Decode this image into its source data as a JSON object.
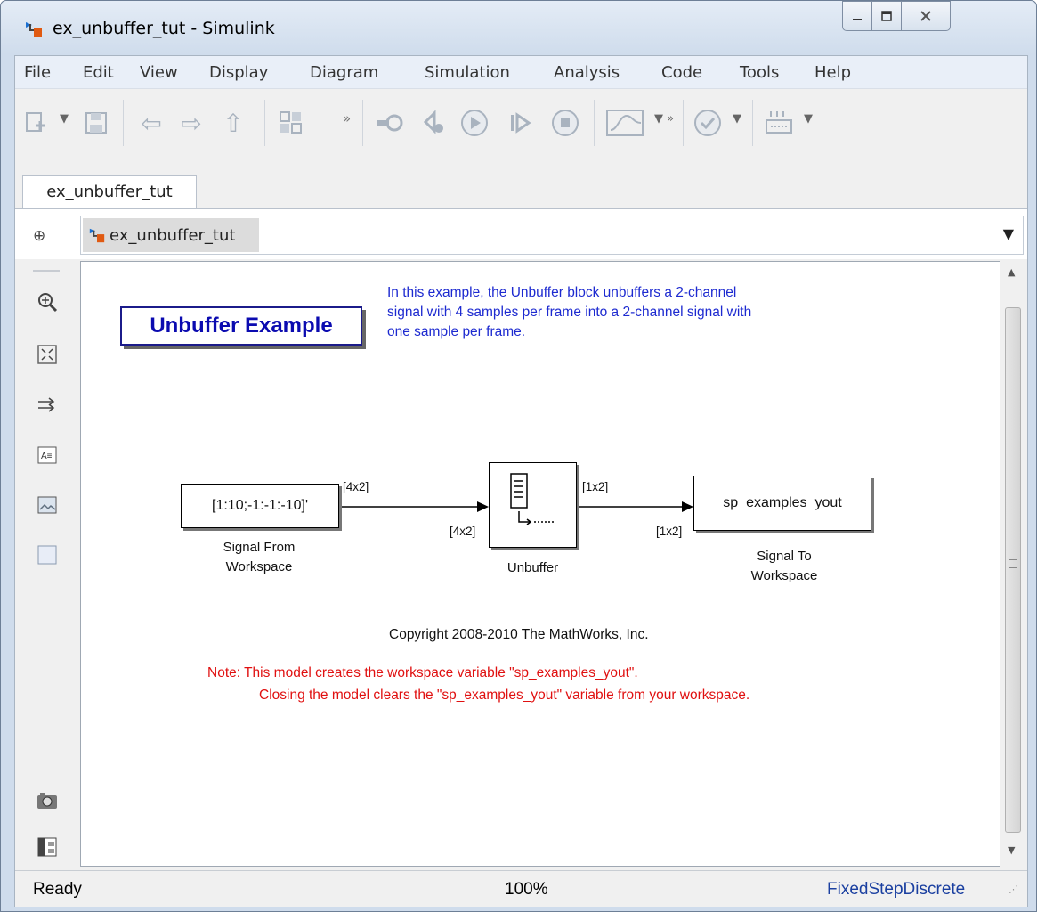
{
  "window": {
    "title": "ex_unbuffer_tut - Simulink"
  },
  "menu": [
    "File",
    "Edit",
    "View",
    "Display",
    "Diagram",
    "Simulation",
    "Analysis",
    "Code",
    "Tools",
    "Help"
  ],
  "tab": {
    "label": "ex_unbuffer_tut"
  },
  "address": {
    "crumb": "ex_unbuffer_tut"
  },
  "diagram": {
    "title": "Unbuffer Example",
    "description": "In this example, the Unbuffer block unbuffers a 2-channel\nsignal with 4 samples per frame into a 2-channel signal with\none sample per frame.",
    "signal_from": {
      "expr": "[1:10;-1:-1:-10]'",
      "label": "Signal From\nWorkspace"
    },
    "unbuffer": {
      "label": "Unbuffer"
    },
    "signal_to": {
      "expr": "sp_examples_yout",
      "label": "Signal To\nWorkspace"
    },
    "dims": {
      "a_out": "[4x2]",
      "a_in": "[4x2]",
      "b_out": "[1x2]",
      "b_in": "[1x2]"
    },
    "copyright": "Copyright 2008-2010 The MathWorks, Inc.",
    "note_line1": "Note: This model creates  the workspace variable \"sp_examples_yout\".",
    "note_line2": "Closing the model clears the \"sp_examples_yout\" variable from your workspace."
  },
  "status": {
    "left": "Ready",
    "zoom": "100%",
    "solver": "FixedStepDiscrete"
  },
  "colors": {
    "note": "#e01010",
    "description": "#1d2ad0",
    "title": "#0b0bb0"
  }
}
